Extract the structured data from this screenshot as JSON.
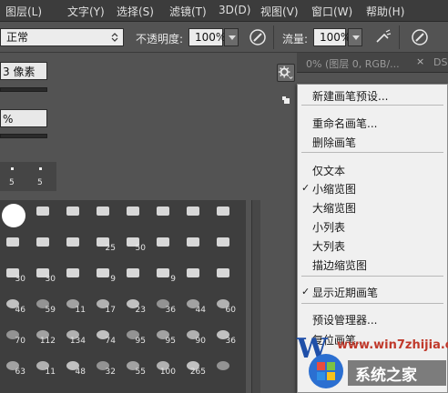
{
  "menubar": {
    "items": [
      "图层(L)",
      "文字(Y)",
      "选择(S)",
      "滤镜(T)",
      "3D(D)",
      "视图(V)",
      "窗口(W)",
      "帮助(H)"
    ]
  },
  "options": {
    "blend_mode": "正常",
    "opacity_label": "不透明度:",
    "opacity_value": "100%",
    "flow_label": "流量:",
    "flow_value": "100%"
  },
  "panel": {
    "size_value": "3 像素",
    "hardness_value": "%"
  },
  "doc_tab": {
    "title": "0% (图层 0, RGB/...",
    "close": "×",
    "next": "DS"
  },
  "recent_brushes": [
    "5",
    "5"
  ],
  "brush_grid": {
    "rows": [
      [
        "",
        "",
        "",
        "",
        "",
        "",
        "",
        ""
      ],
      [
        "",
        "",
        "",
        "25",
        "50",
        "",
        "",
        ""
      ],
      [
        "30",
        "30",
        "",
        "9",
        "",
        "9",
        "",
        ""
      ],
      [
        "46",
        "59",
        "11",
        "17",
        "23",
        "36",
        "44",
        "60"
      ],
      [
        "70",
        "112",
        "134",
        "74",
        "95",
        "95",
        "90",
        "36"
      ],
      [
        "63",
        "11",
        "48",
        "32",
        "55",
        "100",
        "265",
        ""
      ]
    ]
  },
  "context_menu": {
    "items": [
      "新建画笔预设...",
      "重命名画笔...",
      "删除画笔",
      "仅文本",
      "小缩览图",
      "大缩览图",
      "小列表",
      "大列表",
      "描边缩览图",
      "显示近期画笔",
      "预设管理器...",
      "复位画笔..."
    ],
    "check": "✓"
  },
  "watermark": {
    "url": "www.win7zhijia.cn",
    "brand": "系统之家",
    "logo_text": "W"
  },
  "colors": {
    "menubar_bg": "#3c3c3c",
    "panel_bg": "#535353",
    "menu_bg": "#f0f0f0"
  }
}
